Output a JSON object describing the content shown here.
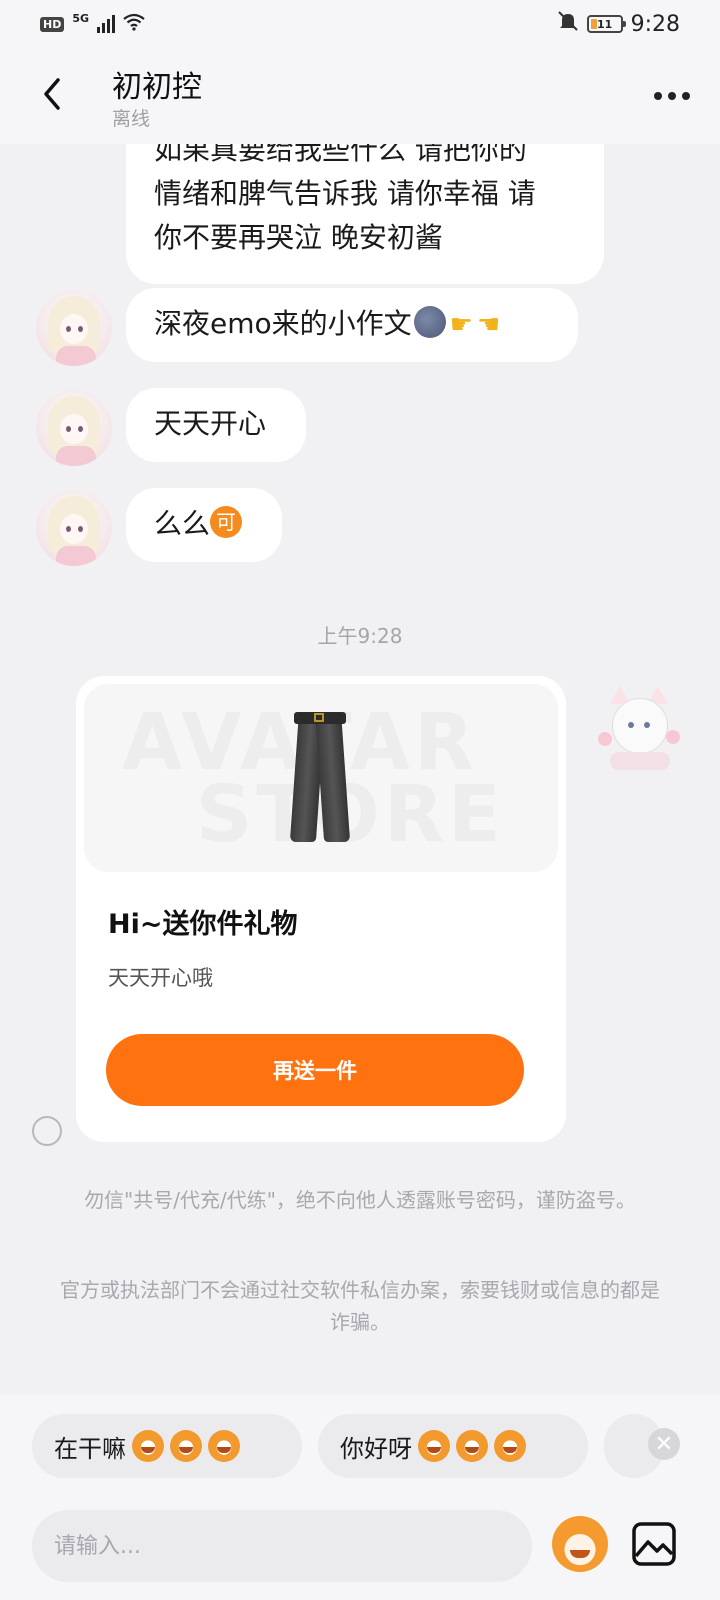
{
  "status_bar": {
    "hd": "HD",
    "network": "5G",
    "battery": "11",
    "time": "9:28"
  },
  "header": {
    "name": "初初控",
    "status": "离线"
  },
  "messages": [
    {
      "lines": [
        "如果真要给我些什么 请把你的",
        "情绪和脾气告诉我 请你幸福 请",
        "你不要再哭泣 晚安初酱"
      ]
    },
    {
      "text": "深夜emo来的小作文"
    },
    {
      "text": "天天开心"
    },
    {
      "text": "么么"
    }
  ],
  "timestamp": "上午9:28",
  "gift_card": {
    "watermark_1": "AVATAR",
    "watermark_2": "STORE",
    "title": "Hi~送你件礼物",
    "subtitle": "天天开心哦",
    "button": "再送一件"
  },
  "inline_icons": {
    "ke": "可"
  },
  "notices": [
    "勿信\"共号/代充/代练\"，绝不向他人透露账号密码，谨防盗号。",
    "官方或执法部门不会通过社交软件私信办案，索要钱财或信息的都是诈骗。"
  ],
  "quick_replies": [
    "在干嘛",
    "你好呀"
  ],
  "input": {
    "placeholder": "请输入..."
  },
  "colors": {
    "accent": "#ff7210",
    "background": "#f1f1f4",
    "bubble": "#ffffff"
  }
}
